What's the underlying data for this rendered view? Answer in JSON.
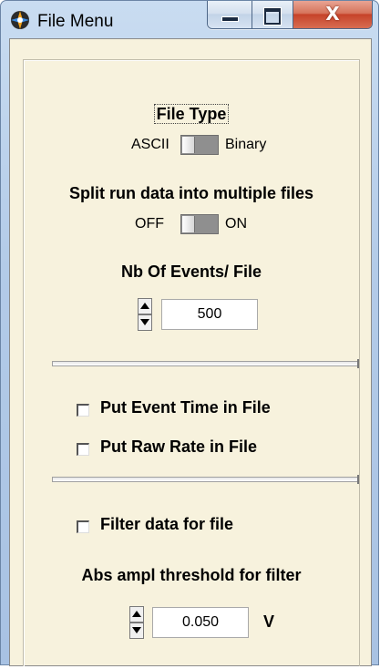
{
  "window": {
    "title": "File Menu"
  },
  "caption": {
    "close_glyph": "X"
  },
  "file_type": {
    "title": "File Type",
    "left_label": "ASCII",
    "right_label": "Binary"
  },
  "split": {
    "title": "Split run data into multiple files",
    "left_label": "OFF",
    "right_label": "ON"
  },
  "events": {
    "title": "Nb Of Events/ File",
    "value": "500"
  },
  "options": {
    "event_time": "Put Event Time in File",
    "raw_rate": "Put Raw Rate in File",
    "filter": "Filter data for file"
  },
  "threshold": {
    "title": "Abs ampl threshold for filter",
    "value": "0.050",
    "unit": "V"
  }
}
